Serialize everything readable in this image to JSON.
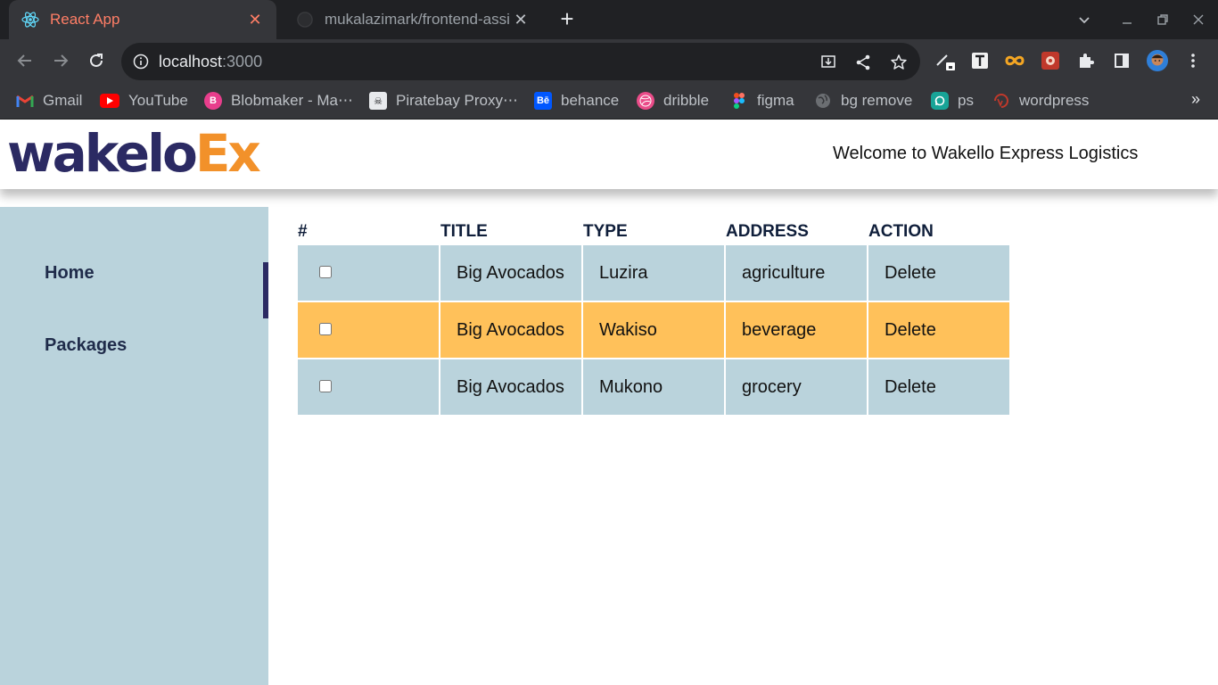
{
  "browser": {
    "tabs": [
      {
        "title": "React App",
        "active": true
      },
      {
        "title": "mukalazimark/frontend-assi",
        "active": false
      }
    ],
    "url_host": "localhost",
    "url_path": ":3000",
    "bookmarks": [
      {
        "label": "Gmail",
        "icon": "gmail-icon"
      },
      {
        "label": "YouTube",
        "icon": "youtube-icon"
      },
      {
        "label": "Blobmaker - Ma⋯",
        "icon": "blobmaker-icon"
      },
      {
        "label": "Piratebay Proxy⋯",
        "icon": "piratebay-icon"
      },
      {
        "label": "behance",
        "icon": "behance-icon"
      },
      {
        "label": "dribble",
        "icon": "dribbble-icon"
      },
      {
        "label": "figma",
        "icon": "figma-icon"
      },
      {
        "label": "bg remove",
        "icon": "globe-icon"
      },
      {
        "label": "ps",
        "icon": "photopea-icon"
      },
      {
        "label": "wordpress",
        "icon": "wordpress-icon"
      }
    ],
    "bookmarks_more": "»"
  },
  "header": {
    "logo_part1": "wakelo",
    "logo_part2": "Ex",
    "welcome": "Welcome to Wakello Express Logistics"
  },
  "sidebar": {
    "items": [
      {
        "label": "Home",
        "active": true
      },
      {
        "label": "Packages",
        "active": false
      }
    ]
  },
  "table": {
    "headers": [
      "#",
      "TITLE",
      "TYPE",
      "ADDRESS",
      "ACTION"
    ],
    "rows": [
      {
        "title": "Big Avocados",
        "type": "Luzira",
        "address": "agriculture",
        "action": "Delete",
        "highlight": false
      },
      {
        "title": "Big Avocados",
        "type": "Wakiso",
        "address": "beverage",
        "action": "Delete",
        "highlight": true
      },
      {
        "title": "Big Avocados",
        "type": "Mukono",
        "address": "grocery",
        "action": "Delete",
        "highlight": false
      }
    ]
  },
  "colors": {
    "sidebar_bg": "#bad3dc",
    "row_highlight": "#ffc15a",
    "logo_dark": "#2b2a63",
    "logo_orange": "#f2912a",
    "tab_title_active": "#ff7e66"
  }
}
